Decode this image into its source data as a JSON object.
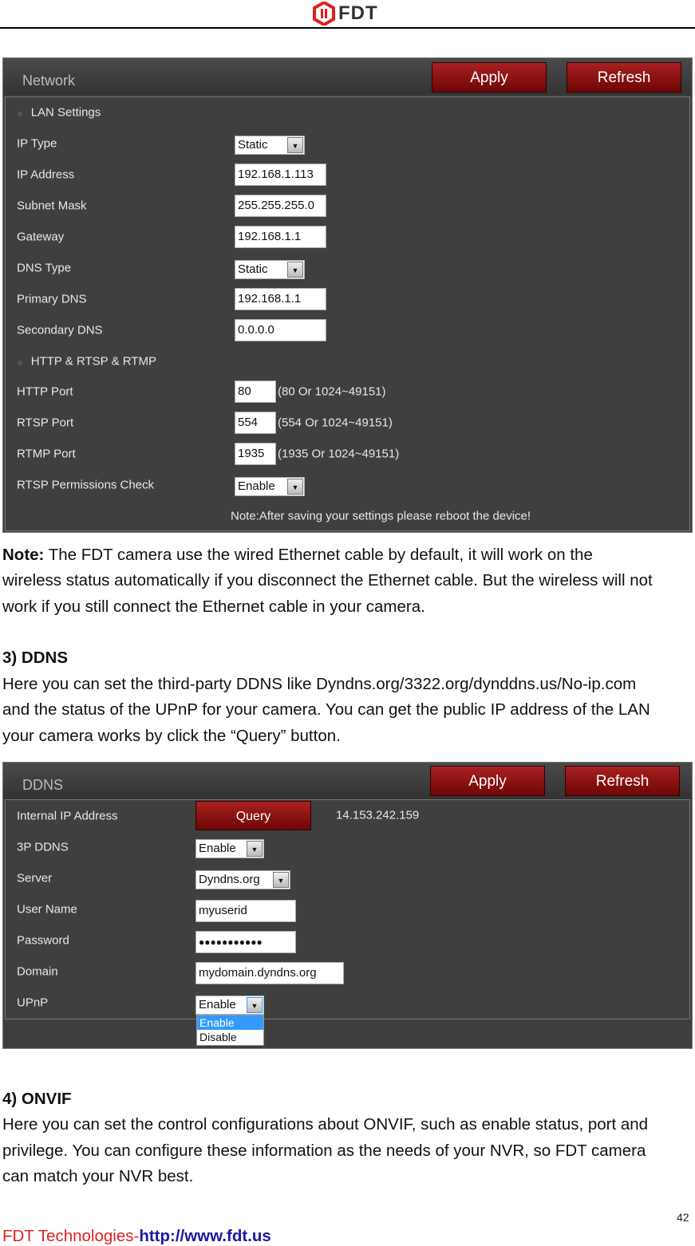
{
  "header": {
    "logo_text": "FDT",
    "logo_color": "#e02020"
  },
  "network": {
    "title": "Network",
    "apply": "Apply",
    "refresh": "Refresh",
    "section_lan": "LAN Settings",
    "ip_type_label": "IP Type",
    "ip_type": "Static",
    "ip_address_label": "IP Address",
    "ip_address": "192.168.1.113",
    "subnet_label": "Subnet Mask",
    "subnet": "255.255.255.0",
    "gateway_label": "Gateway",
    "gateway": "192.168.1.1",
    "dns_type_label": "DNS Type",
    "dns_type": "Static",
    "primary_dns_label": "Primary DNS",
    "primary_dns": "192.168.1.1",
    "secondary_dns_label": "Secondary DNS",
    "secondary_dns": "0.0.0.0",
    "section_http": "HTTP & RTSP & RTMP",
    "http_label": "HTTP Port",
    "http": "80",
    "http_hint": "(80 Or 1024~49151)",
    "rtsp_label": "RTSP Port",
    "rtsp": "554",
    "rtsp_hint": "(554 Or 1024~49151)",
    "rtmp_label": "RTMP Port",
    "rtmp": "1935",
    "rtmp_hint": "(1935 Or 1024~49151)",
    "rtsp_check_label": "RTSP Permissions Check",
    "rtsp_check": "Enable",
    "note": "Note:After saving your settings please reboot the device!"
  },
  "note_para": {
    "label": "Note:",
    "lines": [
      " The FDT camera use the wired Ethernet cable by default, it will work on the",
      "wireless status automatically if you disconnect the Ethernet cable. But the wireless will not",
      "work if you still connect the Ethernet cable in your camera."
    ]
  },
  "ddns_section": {
    "heading": "3) DDNS",
    "lines": [
      "Here you can set the third-party DDNS like Dyndns.org/3322.org/dynddns.us/No-ip.com",
      "and the status of the UPnP for your camera. You can get the public IP address of the LAN",
      "your camera works by click the “Query” button."
    ]
  },
  "ddns": {
    "title": "DDNS",
    "apply": "Apply",
    "refresh": "Refresh",
    "internal_ip_label": "Internal IP Address",
    "query": "Query",
    "ip": "14.153.242.159",
    "p3_label": "3P DDNS",
    "p3": "Enable",
    "server_label": "Server",
    "server": "Dyndns.org",
    "user_label": "User Name",
    "user": "myuserid",
    "password_label": "Password",
    "password": "●●●●●●●●●●●",
    "domain_label": "Domain",
    "domain": "mydomain.dyndns.org",
    "upnp_label": "UPnP",
    "upnp": "Enable",
    "upnp_options": [
      "Enable",
      "Disable"
    ]
  },
  "onvif_section": {
    "heading": "4) ONVIF",
    "lines": [
      "Here you can set the control configurations about ONVIF, such as enable status, port and",
      "privilege. You can configure these information as the needs of your NVR, so FDT camera",
      "can match your NVR best."
    ]
  },
  "footer": {
    "page_number": "42",
    "company": "FDT Technologies-",
    "url": "http://www.fdt.us",
    "company_color": "#e02020",
    "url_color": "#1a1aa0"
  }
}
